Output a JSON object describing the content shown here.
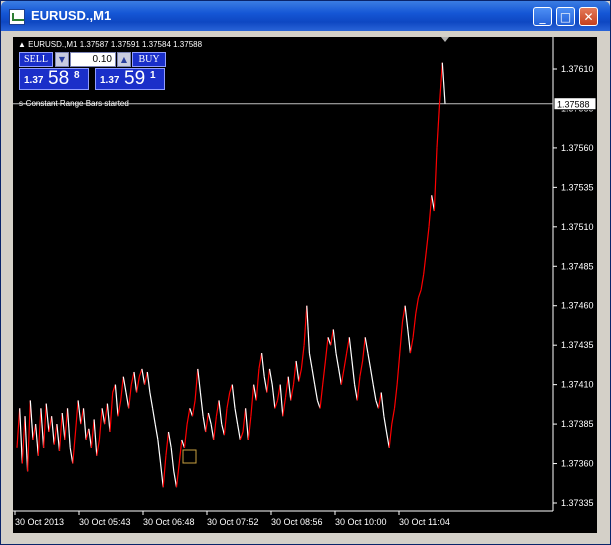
{
  "window": {
    "title": "EURUSD.,M1",
    "minimize_glyph": "_",
    "maximize_glyph": "□",
    "close_glyph": "✕"
  },
  "chart_header": {
    "symbol_line": "▲ EURUSD.,M1  1.37587 1.37591 1.37584 1.37588",
    "status_line": "s-Constant Range Bars started"
  },
  "trade_panel": {
    "sell_label": "SELL",
    "buy_label": "BUY",
    "lot_value": "0.10",
    "lot_down_glyph": "▼",
    "lot_up_glyph": "▲",
    "bid": {
      "prefix": "1.37",
      "big": "58",
      "sup": "8"
    },
    "ask": {
      "prefix": "1.37",
      "big": "59",
      "sup": "1"
    }
  },
  "chart_data": {
    "type": "line",
    "y_ticks": [
      "1.37610",
      "1.37585",
      "1.37560",
      "1.37535",
      "1.37510",
      "1.37485",
      "1.37460",
      "1.37435",
      "1.37410",
      "1.37385",
      "1.37360",
      "1.37335"
    ],
    "y_tick_values": [
      1.3761,
      1.37585,
      1.3756,
      1.37535,
      1.3751,
      1.37485,
      1.3746,
      1.37435,
      1.3741,
      1.37385,
      1.3736,
      1.37335
    ],
    "ylim": [
      1.3733,
      1.3762
    ],
    "x_ticks": [
      "30 Oct 2013",
      "30 Oct 05:43",
      "30 Oct 06:48",
      "30 Oct 07:52",
      "30 Oct 08:56",
      "30 Oct 10:00",
      "30 Oct 11:04"
    ],
    "current_price": 1.37588,
    "current_price_label": "1.37588",
    "grid": false,
    "colors": {
      "background": "#000000",
      "up": "#ff0000",
      "down": "#ffffff",
      "axis": "#ffffff",
      "price_line": "#c0c0c0"
    },
    "series": [
      {
        "values": [
          1.3737,
          1.37395,
          1.3736,
          1.3739,
          1.37355,
          1.374,
          1.37375,
          1.37385,
          1.37365,
          1.37395,
          1.3737,
          1.37398,
          1.3738,
          1.3739,
          1.37372,
          1.37385,
          1.37368,
          1.37392,
          1.37375,
          1.37395,
          1.3737,
          1.3736,
          1.3738,
          1.374,
          1.37385,
          1.37395,
          1.37375,
          1.37382,
          1.3737,
          1.37388,
          1.37365,
          1.37375,
          1.37395,
          1.37385,
          1.37398,
          1.3738,
          1.37405,
          1.3741,
          1.3739,
          1.374,
          1.37415,
          1.37405,
          1.37395,
          1.3741,
          1.37418,
          1.37405,
          1.37415,
          1.3742,
          1.3741,
          1.37418,
          1.37405,
          1.37395,
          1.37385,
          1.37375,
          1.3736,
          1.37345,
          1.37365,
          1.3738,
          1.3737,
          1.37355,
          1.37345,
          1.3736,
          1.37375,
          1.3737,
          1.37385,
          1.37395,
          1.3739,
          1.374,
          1.3742,
          1.37405,
          1.3739,
          1.3738,
          1.37392,
          1.37385,
          1.37375,
          1.3739,
          1.374,
          1.37385,
          1.37378,
          1.37395,
          1.37405,
          1.3741,
          1.37395,
          1.37385,
          1.37375,
          1.3738,
          1.37395,
          1.37375,
          1.3739,
          1.3741,
          1.374,
          1.3742,
          1.3743,
          1.37415,
          1.37405,
          1.3742,
          1.3741,
          1.37395,
          1.374,
          1.3741,
          1.3739,
          1.37402,
          1.37415,
          1.374,
          1.3741,
          1.37425,
          1.37412,
          1.3742,
          1.37435,
          1.3746,
          1.3743,
          1.3742,
          1.3741,
          1.374,
          1.37395,
          1.3741,
          1.37425,
          1.3744,
          1.37435,
          1.37445,
          1.3743,
          1.3742,
          1.3741,
          1.3742,
          1.3743,
          1.3744,
          1.37425,
          1.3741,
          1.374,
          1.37415,
          1.37425,
          1.3744,
          1.3743,
          1.3742,
          1.3741,
          1.374,
          1.37395,
          1.37405,
          1.3739,
          1.3738,
          1.3737,
          1.37385,
          1.37395,
          1.3741,
          1.3743,
          1.3745,
          1.3746,
          1.37445,
          1.3743,
          1.3744,
          1.37455,
          1.37465,
          1.3747,
          1.3748,
          1.37495,
          1.3751,
          1.3753,
          1.3752,
          1.3756,
          1.3759,
          1.37614,
          1.37588
        ]
      }
    ]
  }
}
